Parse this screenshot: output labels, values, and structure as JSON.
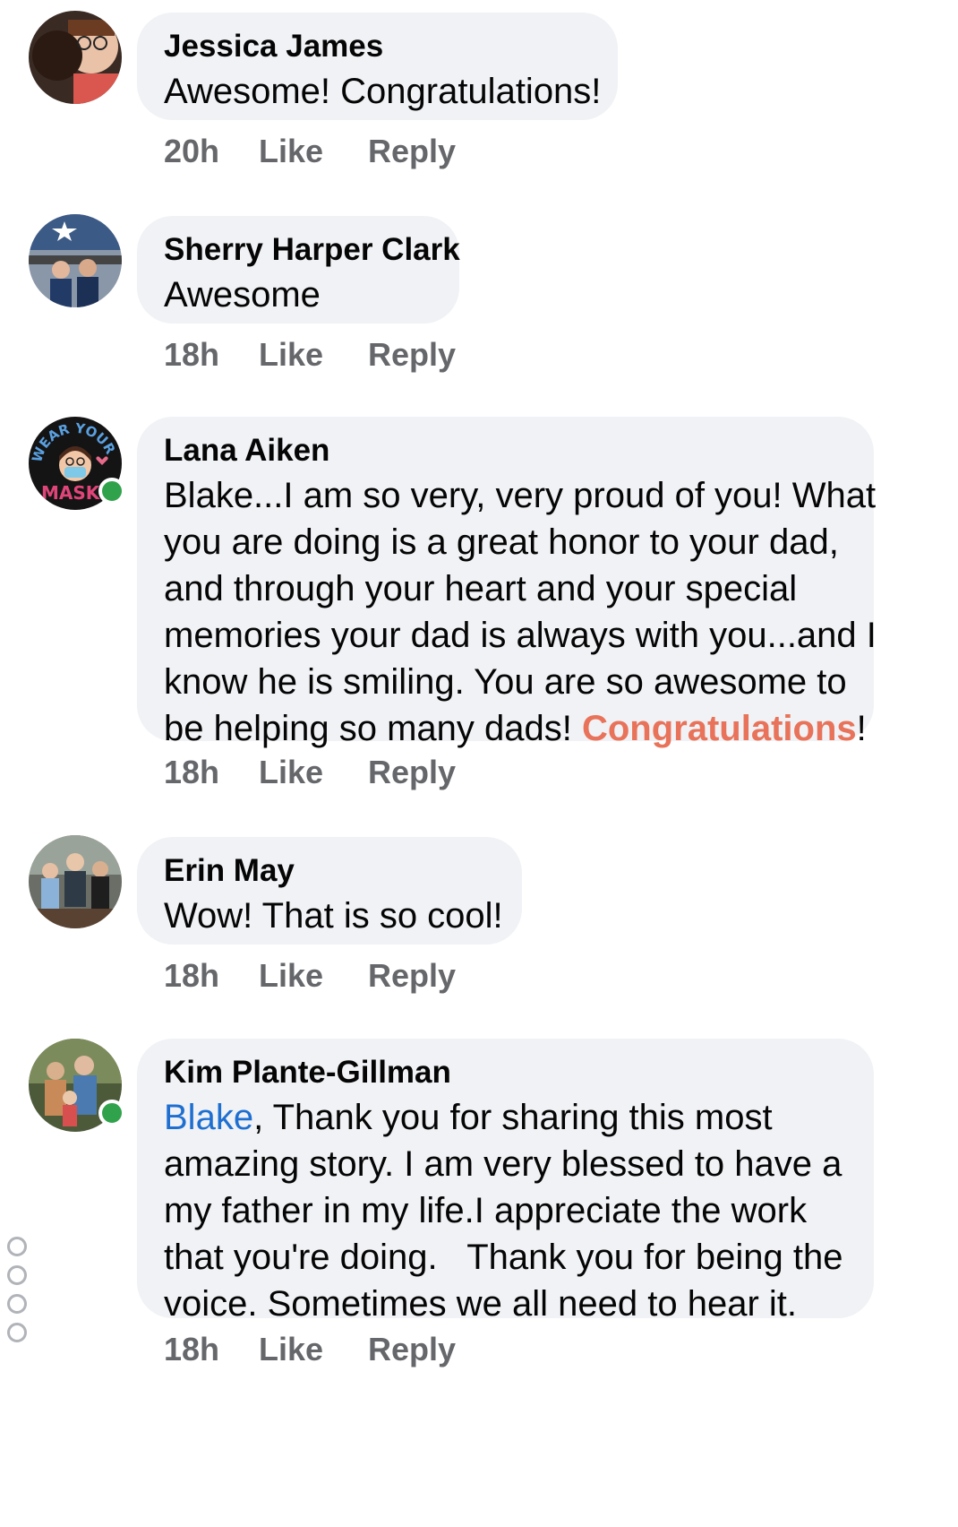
{
  "comments": [
    {
      "author": "Jessica James",
      "lines": [
        "Awesome! Congratulations!"
      ],
      "time": "20h",
      "like": "Like",
      "reply": "Reply",
      "online": false
    },
    {
      "author": "Sherry Harper Clark",
      "lines": [
        "Awesome"
      ],
      "time": "18h",
      "like": "Like",
      "reply": "Reply",
      "online": false
    },
    {
      "author": "Lana Aiken",
      "lines": [
        "Blake...I am so very, very proud of you! What",
        "you are doing is a great honor to your dad,",
        "and through your heart and your special",
        "memories your dad is always with you...and I",
        "know he is smiling. You are so awesome to",
        "be helping so many dads! "
      ],
      "highlight": "Congratulations",
      "after_highlight": "!",
      "time": "18h",
      "like": "Like",
      "reply": "Reply",
      "online": true,
      "avatar_text_top": "WEAR YOUR",
      "avatar_text_bottom": "MASK"
    },
    {
      "author": "Erin May",
      "lines": [
        "Wow! That is so cool!"
      ],
      "time": "18h",
      "like": "Like",
      "reply": "Reply",
      "online": false
    },
    {
      "author": "Kim Plante-Gillman",
      "mention": "Blake",
      "first_line_rest": ", Thank you for sharing this most",
      "lines": [
        "amazing story. I am very blessed to have a",
        "my father in my life.I appreciate the work",
        "that you're doing.   Thank you for being the",
        "voice. Sometimes we all need to hear it."
      ],
      "time": "18h",
      "like": "Like",
      "reply": "Reply",
      "online": true
    }
  ],
  "colors": {
    "bubble": "#f0f2f5",
    "meta": "#65676b",
    "highlight": "#e8735a",
    "mention": "#1f6fd1",
    "online": "#31a24c"
  }
}
